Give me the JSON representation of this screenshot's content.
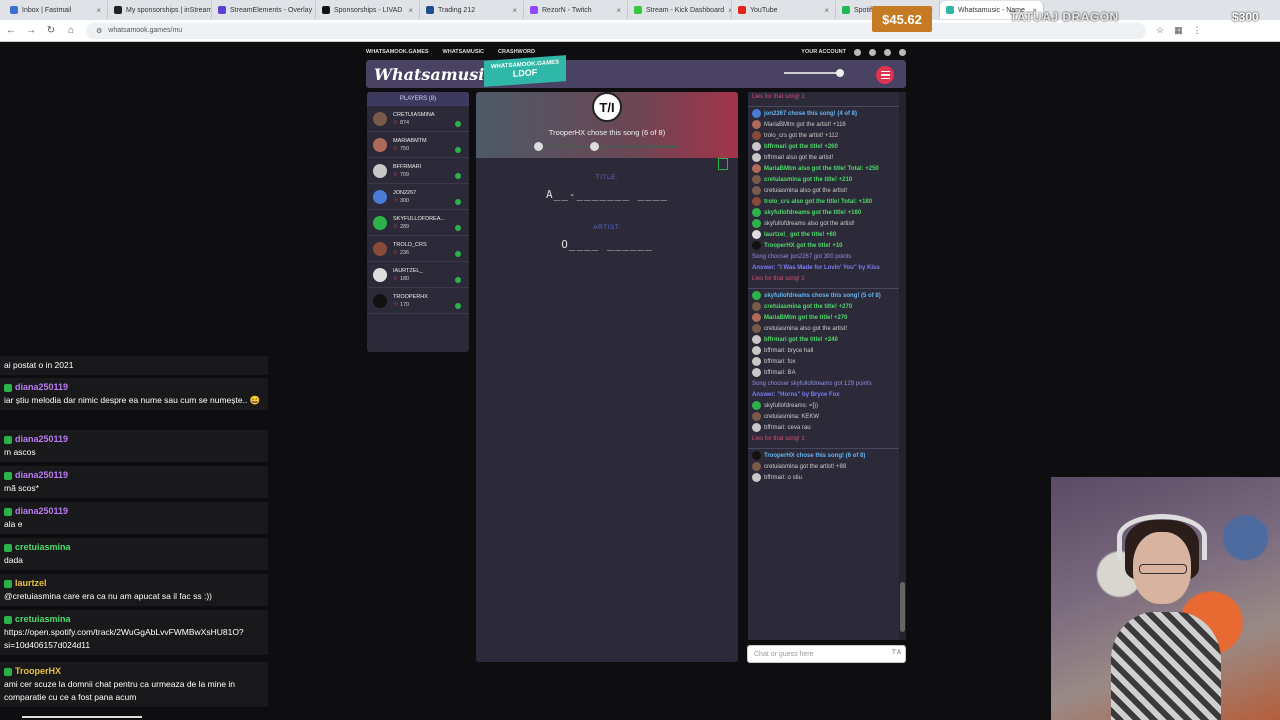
{
  "browser": {
    "tabs": [
      {
        "label": "Inbox | Fastmail",
        "color": "#3b6fd1"
      },
      {
        "label": "My sponsorships | inStream",
        "color": "#222222"
      },
      {
        "label": "StreamElements - Overlay",
        "color": "#5b3fd6"
      },
      {
        "label": "Sponsorships - LIVAD",
        "color": "#111111"
      },
      {
        "label": "Trading 212",
        "color": "#1f4d8f"
      },
      {
        "label": "RezorN - Twitch",
        "color": "#9146ff"
      },
      {
        "label": "Stream - Kick Dashboard",
        "color": "#35c93b"
      },
      {
        "label": "YouTube",
        "color": "#e62117"
      },
      {
        "label": "Spotify - Liked Songs",
        "color": "#1db954"
      },
      {
        "label": "Whatsamusic - Name",
        "color": "#2fb8a8"
      }
    ],
    "url": "whatsamook.games/mu"
  },
  "overlay": {
    "donation": "$45.62",
    "title": "TATUAJ DRAGON",
    "amount": "$300"
  },
  "site": {
    "nav": [
      "WHATSAMOOK.GAMES",
      "WHATSAMUSIC",
      "CRASHWORD"
    ],
    "account": "YOUR ACCOUNT",
    "logo": "Whatsamusic",
    "ribbon_site": "WHATSAMOOK.GAMES",
    "ribbon_code": "LDOF"
  },
  "players": {
    "header": "PLAYERS (8)",
    "list": [
      {
        "name": "CRETUIASMINA",
        "score": "874",
        "color": "#7a5a48"
      },
      {
        "name": "MARIABMTM",
        "score": "750",
        "color": "#b06a5a"
      },
      {
        "name": "BFFRMARI",
        "score": "709",
        "color": "#c8c8c8"
      },
      {
        "name": "JON2267",
        "score": "300",
        "color": "#4a7bd6"
      },
      {
        "name": "SKYFULLOFDREA...",
        "score": "289",
        "color": "#2bb34a"
      },
      {
        "name": "TROLO_CRS",
        "score": "236",
        "color": "#8a4a3a"
      },
      {
        "name": "IAURTZEL_",
        "score": "180",
        "color": "#dddddd"
      },
      {
        "name": "TROOPERHX",
        "score": "170",
        "color": "#111111"
      }
    ]
  },
  "game": {
    "chooser_initials": "T/I",
    "chosen": "TrooperHX chose this song (6 of 8)",
    "title_label": "TITLE:",
    "title_hint": "A__-_______ ____",
    "artist_label": "ARTIST:",
    "artist_hint": "O____ ______"
  },
  "chat": {
    "messages": [
      {
        "type": "fail",
        "text": "Lies for that song! 1"
      },
      {
        "type": "choose sep",
        "text": "jon2267 chose this song! (4 of 8)",
        "av": "#4a7bd6"
      },
      {
        "type": "plain",
        "text": "MariaBMtm got the artist! +116",
        "av": "#b06a5a"
      },
      {
        "type": "plain",
        "text": "trolo_crs got the artist! +112",
        "av": "#8a4a3a"
      },
      {
        "type": "green",
        "text": "bffrmari got the title! +260",
        "av": "#c8c8c8"
      },
      {
        "type": "plain",
        "text": "bffrmari also got the artist!",
        "av": "#c8c8c8"
      },
      {
        "type": "green",
        "text": "MariaBMtm also got the title! Total: +250",
        "av": "#b06a5a"
      },
      {
        "type": "green",
        "text": "cretuiasmina got the title! +210",
        "av": "#7a5a48"
      },
      {
        "type": "plain",
        "text": "cretuiasmina also got the artist!",
        "av": "#7a5a48"
      },
      {
        "type": "green",
        "text": "trolo_crs also got the title! Total: +180",
        "av": "#8a4a3a"
      },
      {
        "type": "green",
        "text": "skyfullofdreams got the title! +160",
        "av": "#2bb34a"
      },
      {
        "type": "plain",
        "text": "skyfullofdreams also got the artist!",
        "av": "#2bb34a"
      },
      {
        "type": "green",
        "text": "laurtzel_ got the title! +60",
        "av": "#dddddd"
      },
      {
        "type": "green",
        "text": "TrooperHX got the title! +10",
        "av": "#111111"
      },
      {
        "type": "sys",
        "text": "Song chooser jon2267 got 300 points"
      },
      {
        "type": "ans",
        "text": "Answer: \"I Was Made for Lovin' You\" by Kiss"
      },
      {
        "type": "fail",
        "text": "Lies for that song! 2"
      },
      {
        "type": "choose sep",
        "text": "skyfullofdreams chose this song! (5 of 8)",
        "av": "#2bb34a"
      },
      {
        "type": "green",
        "text": "cretuiasmina got the title! +270",
        "av": "#7a5a48"
      },
      {
        "type": "green",
        "text": "MariaBMtm got the title! +270",
        "av": "#b06a5a"
      },
      {
        "type": "plain",
        "text": "cretuiasmina also got the artist!",
        "av": "#7a5a48"
      },
      {
        "type": "green",
        "text": "bffrmari got the title! +240",
        "av": "#c8c8c8"
      },
      {
        "type": "plain",
        "text": "bffrmari: bryce hall",
        "av": "#c8c8c8"
      },
      {
        "type": "plain",
        "text": "bffrmari: fox",
        "av": "#c8c8c8"
      },
      {
        "type": "plain",
        "text": "bffrmari: BA",
        "av": "#c8c8c8"
      },
      {
        "type": "sys",
        "text": "Song chooser skyfullofdreams got 129 points"
      },
      {
        "type": "ans",
        "text": "Answer: \"Horns\" by Bryce Fox"
      },
      {
        "type": "plain",
        "text": "skyfullofdreams: =]))",
        "av": "#2bb34a"
      },
      {
        "type": "plain",
        "text": "cretuiasmina: KEKW",
        "av": "#7a5a48"
      },
      {
        "type": "plain",
        "text": "bffrmari: ceva rau",
        "av": "#c8c8c8"
      },
      {
        "type": "fail",
        "text": "Lies for that song! 1"
      },
      {
        "type": "choose sep",
        "text": "TrooperHX chose this song! (6 of 8)",
        "av": "#111111"
      },
      {
        "type": "plain",
        "text": "cretuiasmina got the artist! +88",
        "av": "#7a5a48"
      },
      {
        "type": "plain",
        "text": "bffrmari: o stiu",
        "av": "#c8c8c8"
      }
    ],
    "input_placeholder": "Chat or guess here",
    "input_icon": "T A"
  },
  "stream_chat": [
    {
      "name": "",
      "text": "ai postat o in 2021",
      "color": "#ffffff"
    },
    {
      "name": "diana250119",
      "text": "iar știu melodia dar nimic despre ea nume sau cum se numește.. 😄",
      "color": "#b97cf0"
    },
    {
      "name": "diana250119",
      "text": "m ascos",
      "color": "#b97cf0"
    },
    {
      "name": "diana250119",
      "text": "mă scos*",
      "color": "#b97cf0"
    },
    {
      "name": "diana250119",
      "text": "ala e",
      "color": "#b97cf0"
    },
    {
      "name": "cretuiasmina",
      "text": "dada",
      "color": "#4ed96b"
    },
    {
      "name": "laurtzel",
      "text": "@cretuiasmina care era ca nu am apucat sa il fac ss :))",
      "color": "#e8c23a"
    },
    {
      "name": "cretuiasmina",
      "text": "https://open.spotify.com/track/2WuGgAbLvvFWMBwXsHU81O?si=10d406157d024d11",
      "color": "#4ed96b"
    },
    {
      "name": "TrooperHX",
      "text": "ami cer scuze la domnii chat pentru ca urmeaza de la mine in comparatie cu ce a fost pana acum",
      "color": "#e8c23a"
    }
  ]
}
